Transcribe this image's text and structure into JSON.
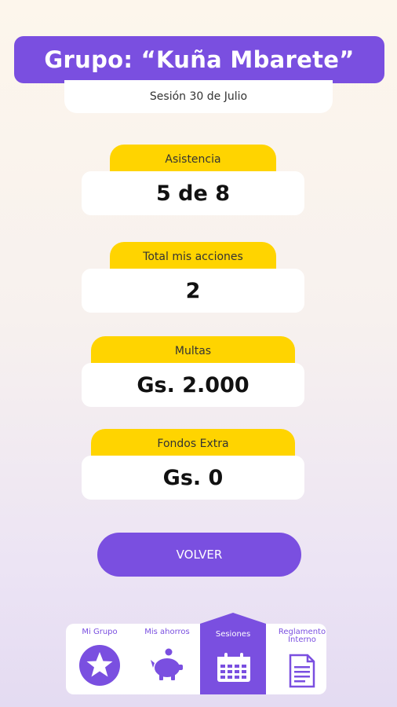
{
  "header": {
    "title": "Grupo: “Kuña Mbarete”",
    "session": "Sesión 30 de Julio"
  },
  "stats": [
    {
      "label": "Asistencia",
      "value": "5 de 8"
    },
    {
      "label": "Total mis acciones",
      "value": "2"
    },
    {
      "label": "Multas",
      "value": "Gs. 2.000"
    },
    {
      "label": "Fondos Extra",
      "value": "Gs. 0"
    }
  ],
  "back_button": {
    "label": "VOLVER"
  },
  "nav": {
    "items": [
      {
        "label": "Mi Grupo",
        "icon": "star-icon"
      },
      {
        "label": "Mis ahorros",
        "icon": "piggy-bank-icon"
      },
      {
        "label": "Sesiones",
        "icon": "calendar-icon",
        "active": true
      },
      {
        "label": "Reglamento Interno",
        "icon": "document-icon"
      }
    ]
  },
  "colors": {
    "primary": "#7a4fe0",
    "accent": "#ffd400",
    "card": "#ffffff"
  }
}
